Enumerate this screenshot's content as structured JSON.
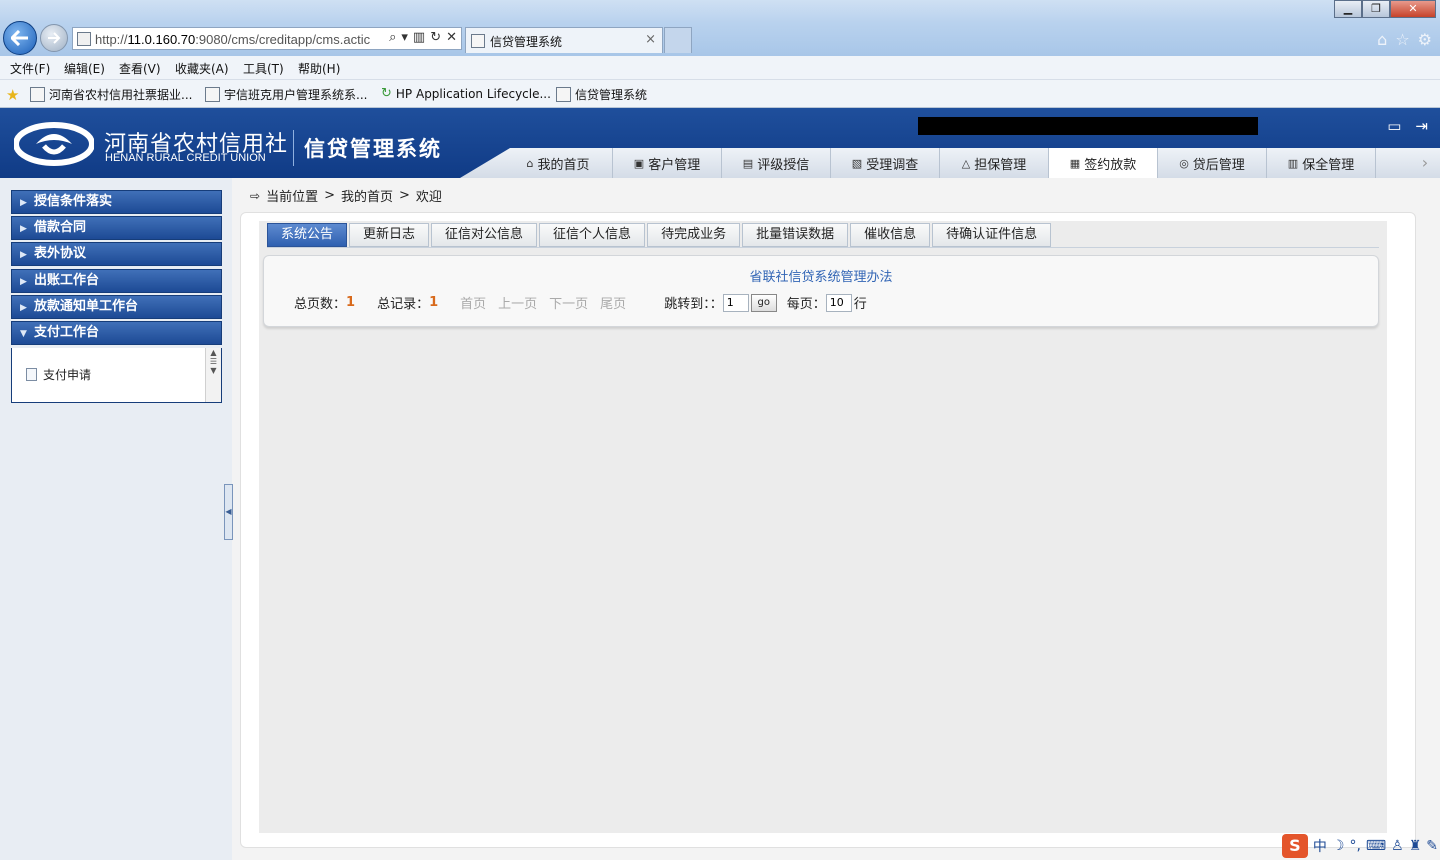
{
  "browser": {
    "url_prefix": "http://",
    "url_host": "11.0.160.70",
    "url_rest": ":9080/cms/creditapp/cms.actic",
    "tab_title": "信贷管理系统",
    "tab_close": "×",
    "window_buttons": [
      "▁",
      "❐",
      "✕"
    ],
    "menus": [
      "文件(F)",
      "编辑(E)",
      "查看(V)",
      "收藏夹(A)",
      "工具(T)",
      "帮助(H)"
    ],
    "favorites": [
      "河南省农村信用社票据业...",
      "宇信班克用户管理系统系...",
      "HP Application Lifecycle...",
      "信贷管理系统"
    ]
  },
  "header": {
    "brand_cn": "河南省农村信用社",
    "brand_en": "HENAN RURAL CREDIT UNION",
    "system_name": "信贷管理系统",
    "nav": [
      {
        "label": "我的首页",
        "icon": "home-icon",
        "glyph": "⌂"
      },
      {
        "label": "客户管理",
        "icon": "customer-icon",
        "glyph": "▣"
      },
      {
        "label": "评级授信",
        "icon": "rating-icon",
        "glyph": "▤"
      },
      {
        "label": "受理调查",
        "icon": "survey-icon",
        "glyph": "▧"
      },
      {
        "label": "担保管理",
        "icon": "guarantee-icon",
        "glyph": "△"
      },
      {
        "label": "签约放款",
        "icon": "contract-icon",
        "glyph": "▦",
        "active": true
      },
      {
        "label": "贷后管理",
        "icon": "post-loan-icon",
        "glyph": "◎"
      },
      {
        "label": "保全管理",
        "icon": "preservation-icon",
        "glyph": "▥"
      }
    ]
  },
  "sidebar": {
    "items": [
      "授信条件落实",
      "借款合同",
      "表外协议",
      "出账工作台",
      "放款通知单工作台",
      "支付工作台"
    ],
    "expanded_sub": "支付申请"
  },
  "breadcrumb": {
    "label": "当前位置",
    "sep": ">",
    "home": "我的首页",
    "current": "欢迎"
  },
  "tabs": [
    "系统公告",
    "更新日志",
    "征信对公信息",
    "征信个人信息",
    "待完成业务",
    "批量错误数据",
    "催收信息",
    "待确认证件信息"
  ],
  "notice": {
    "title": "省联社信贷系统管理办法"
  },
  "pager": {
    "total_pages_label": "总页数：",
    "total_pages": "1",
    "total_records_label": "总记录：",
    "total_records": "1",
    "first": "首页",
    "prev": "上一页",
    "next": "下一页",
    "last": "尾页",
    "jump_label": "跳转到：：",
    "jump_value": "1",
    "go": "go",
    "per_page_label": "每页：",
    "per_page_value": "10",
    "row_unit": "行"
  },
  "tray": {
    "ime_logo": "S",
    "ime_mode": "中"
  },
  "colors": {
    "header_blue": "#1f4f9c",
    "sidebar_item": "#2f5da8",
    "active_tab": "#3a6bbb",
    "count_orange": "#d86a1c",
    "notice_link": "#3265b5"
  }
}
